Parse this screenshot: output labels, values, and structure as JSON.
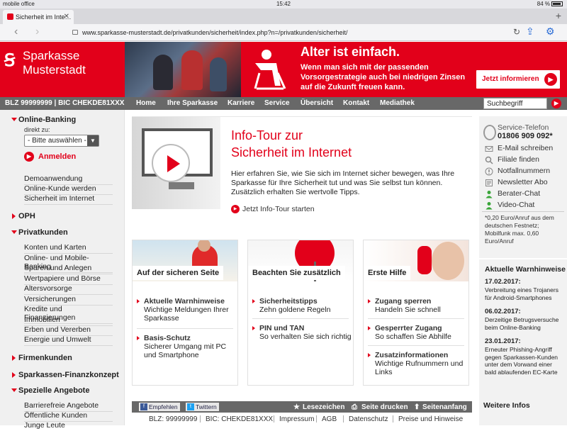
{
  "status": {
    "carrier": "mobile office",
    "time": "15:42",
    "battery": "84 %"
  },
  "browser": {
    "tab_title": "Sicherheit im Inte…",
    "url": "www.sparkasse-musterstadt.de/privatkunden/sicherheit/index.php?n=/privatkunden/sicherheit/"
  },
  "header": {
    "logo_line1": "Sparkasse",
    "logo_line2": "Musterstadt",
    "ad_title": "Alter ist einfach.",
    "ad_text_1": "Wenn man sich mit der passenden",
    "ad_text_2": "Vorsorgestrategie auch bei niedrigen Zinsen",
    "ad_text_3": "auf die Zukunft freuen kann.",
    "ad_button": "Jetzt informieren"
  },
  "navbar": {
    "blz": "BLZ 99999999 | BIC CHEKDE81XXX",
    "items": [
      "Home",
      "Ihre Sparkasse",
      "Karriere",
      "Service",
      "Übersicht",
      "Kontakt",
      "Mediathek"
    ],
    "search_value": "Suchbegriff"
  },
  "sidebar": {
    "online_banking": "Online-Banking",
    "direkt_zu": "direkt zu:",
    "select_value": "- Bitte auswählen -",
    "anmelden": "Anmelden",
    "links_1": [
      "Demoanwendung",
      "Online-Kunde werden",
      "Sicherheit im Internet"
    ],
    "oph": "OPH",
    "privatkunden": "Privatkunden",
    "links_2": [
      "Konten und Karten",
      "Online- und Mobile-Banking",
      "Sparen und Anlegen",
      "Wertpapiere und Börse",
      "Altersvorsorge",
      "Versicherungen",
      "Kredite und Finanzierungen",
      "Immobilien",
      "Erben und Vererben",
      "Energie und Umwelt"
    ],
    "firmenkunden": "Firmenkunden",
    "finanzkonzept": "Sparkassen-Finanzkonzept",
    "spezielle": "Spezielle Angebote",
    "links_3": [
      "Barrierefreie Angebote",
      "Öffentliche Kunden",
      "Junge Leute"
    ]
  },
  "hero": {
    "title_1": "Info-Tour zur",
    "title_2": "Sicherheit im Internet",
    "text": "Hier erfahren Sie, wie Sie sich im Internet sicher bewegen, was Ihre Sparkasse für Ihre Sicherheit tut und was Sie selbst tun können. Zusätzlich erhalten Sie wertvolle Tipps.",
    "link": "Jetzt Info-Tour starten"
  },
  "cards": [
    {
      "title": "Auf der sicheren Seite",
      "items": [
        {
          "head": "Aktuelle Warnhinweise",
          "sub": "Wichtige Meldungen Ihrer Sparkasse"
        },
        {
          "head": "Basis-Schutz",
          "sub": "Sicherer Umgang mit PC und Smartphone"
        }
      ]
    },
    {
      "title": "Beachten Sie zusätzlich",
      "items": [
        {
          "head": "Sicherheitstipps",
          "sub": "Zehn goldene Regeln"
        },
        {
          "head": "PIN und TAN",
          "sub": "So verhalten Sie sich richtig"
        }
      ]
    },
    {
      "title": "Erste Hilfe",
      "items": [
        {
          "head": "Zugang sperren",
          "sub": "Handeln Sie schnell"
        },
        {
          "head": "Gesperrter Zugang",
          "sub": "So schaffen Sie Abhilfe"
        },
        {
          "head": "Zusatzinformationen",
          "sub": "Wichtige Rufnummern und Links"
        }
      ]
    }
  ],
  "service": {
    "head": "Service-Telefon",
    "number": "01806 909 092*",
    "items": [
      "E-Mail schreiben",
      "Filiale finden",
      "Notfallnummern",
      "Newsletter Abo",
      "Berater-Chat",
      "Video-Chat"
    ],
    "note": "*0,20 Euro/Anruf aus dem deutschen Festnetz; Mobilfunk max. 0,60 Euro/Anruf"
  },
  "warnings": {
    "title": "Aktuelle Warnhinweise",
    "entries": [
      {
        "date": "17.02.2017:",
        "text": "Verbreitung eines Trojaners für Android-Smartphones"
      },
      {
        "date": "06.02.2017:",
        "text": "Derzeitige Betrugsversuche beim Online-Banking"
      },
      {
        "date": "23.01.2017:",
        "text": "Erneuter Phishing-Angriff gegen Sparkassen-Kunden unter dem Vorwand einer bald ablaufenden EC-Karte"
      }
    ],
    "weitere": "Weitere Infos"
  },
  "share": {
    "facebook": "Empfehlen",
    "twitter": "Twittern",
    "bookmark": "Lesezeichen",
    "print": "Seite drucken",
    "top": "Seitenanfang"
  },
  "footer": [
    "BLZ: 99999999",
    "BIC: CHEKDE81XXX",
    "Impressum",
    "AGB",
    "Datenschutz",
    "Preise und Hinweise"
  ],
  "colors": {
    "brand_red": "#e2001a",
    "nav_gray": "#686868"
  }
}
